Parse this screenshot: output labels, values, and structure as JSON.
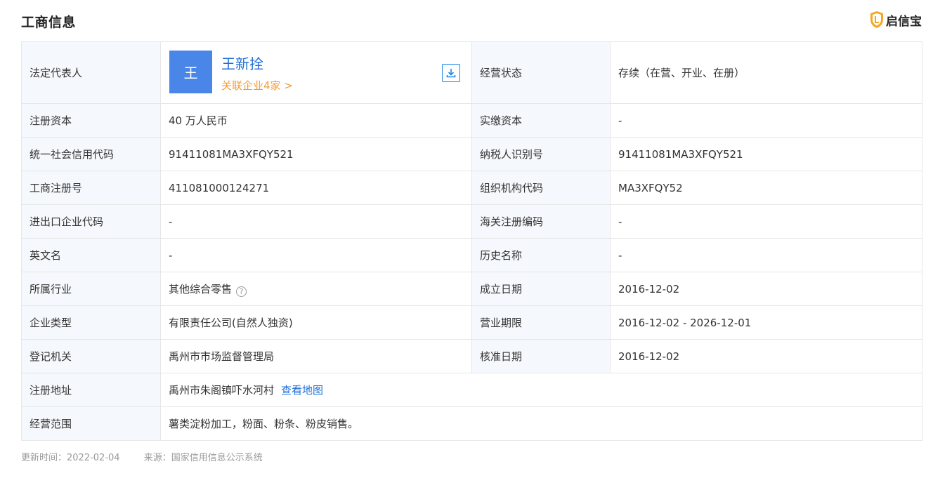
{
  "header": {
    "title": "工商信息",
    "brand": "启信宝",
    "brand_color": "#f5a623"
  },
  "rep": {
    "label": "法定代表人",
    "avatar_char": "王",
    "name": "王新拴",
    "related": "关联企业4家 >",
    "download_icon": "download-icon"
  },
  "status": {
    "label": "经营状态",
    "value": "存续（在营、开业、在册）"
  },
  "rows": [
    {
      "l1": "注册资本",
      "v1": "40 万人民币",
      "l2": "实缴资本",
      "v2": "-"
    },
    {
      "l1": "统一社会信用代码",
      "v1": "91411081MA3XFQY521",
      "l2": "纳税人识别号",
      "v2": "91411081MA3XFQY521"
    },
    {
      "l1": "工商注册号",
      "v1": "411081000124271",
      "l2": "组织机构代码",
      "v2": "MA3XFQY52"
    },
    {
      "l1": "进出口企业代码",
      "v1": "-",
      "l2": "海关注册编码",
      "v2": "-"
    },
    {
      "l1": "英文名",
      "v1": "-",
      "l2": "历史名称",
      "v2": "-"
    },
    {
      "l1": "所属行业",
      "v1": "其他综合零售",
      "l2": "成立日期",
      "v2": "2016-12-02"
    },
    {
      "l1": "企业类型",
      "v1": "有限责任公司(自然人独资)",
      "l2": "营业期限",
      "v2": "2016-12-02 - 2026-12-01"
    },
    {
      "l1": "登记机关",
      "v1": "禹州市市场监督管理局",
      "l2": "核准日期",
      "v2": "2016-12-02"
    }
  ],
  "address": {
    "label": "注册地址",
    "value": "禹州市朱阁镇吓水河村",
    "map_link": "查看地图"
  },
  "scope": {
    "label": "经营范围",
    "value": "薯类淀粉加工，粉面、粉条、粉皮销售。"
  },
  "footer": {
    "updated": "更新时间：2022-02-04",
    "source": "来源：国家信用信息公示系统"
  }
}
